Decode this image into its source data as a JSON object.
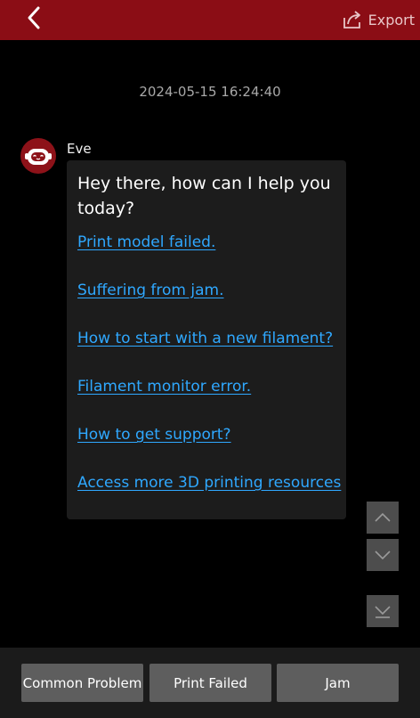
{
  "header": {
    "export_label": "Export",
    "colors": {
      "bar": "#8b0d15"
    }
  },
  "chat": {
    "timestamp": "2024-05-15 16:24:40",
    "message": {
      "sender": "Eve",
      "avatar_icon": "robot-icon",
      "greeting": "Hey there, how can I help you today?",
      "links": [
        "Print model failed.",
        "Suffering from jam.",
        "How to start with a new filament?",
        "Filament monitor error.",
        "How to get support?",
        "Access more 3D printing resources"
      ]
    }
  },
  "scroll_controls": {
    "icons": [
      "chevron-up-icon",
      "chevron-down-icon",
      "scroll-to-bottom-icon"
    ]
  },
  "quick_replies": [
    "Common Problem",
    "Print Failed",
    "Jam"
  ]
}
